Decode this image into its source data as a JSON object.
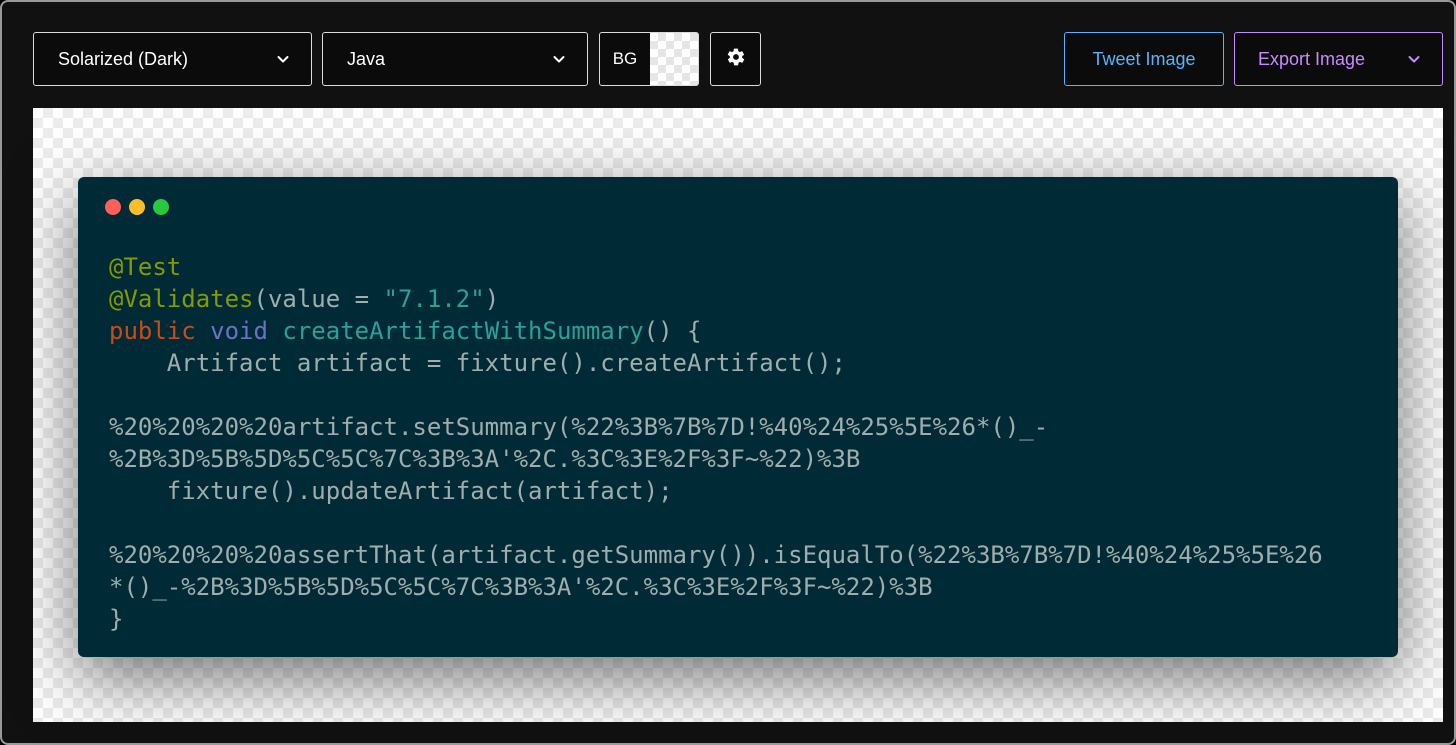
{
  "toolbar": {
    "theme_select": {
      "value": "Solarized (Dark)"
    },
    "language_select": {
      "value": "Java"
    },
    "bg_picker": {
      "label": "BG"
    },
    "tweet_button": {
      "label": "Tweet Image"
    },
    "export_button": {
      "label": "Export Image"
    },
    "icons": {
      "settings": "gear-icon",
      "dropdown": "chevron-down-icon"
    }
  },
  "window": {
    "controls": [
      "close",
      "minimize",
      "maximize"
    ],
    "colors": {
      "background": "#002b36",
      "close": "#ff5f56",
      "minimize": "#ffbd2e",
      "maximize": "#27c93f"
    }
  },
  "code": {
    "language": "Java",
    "lines": [
      [
        {
          "t": "@Test",
          "k": "ann"
        }
      ],
      [
        {
          "t": "@Validates",
          "k": "ann"
        },
        {
          "t": "(value = ",
          "k": "plain"
        },
        {
          "t": "\"7.1.2\"",
          "k": "str"
        },
        {
          "t": ")",
          "k": "plain"
        }
      ],
      [
        {
          "t": "public",
          "k": "kw"
        },
        {
          "t": " ",
          "k": "plain"
        },
        {
          "t": "void",
          "k": "type"
        },
        {
          "t": " ",
          "k": "plain"
        },
        {
          "t": "createArtifactWithSummary",
          "k": "fn"
        },
        {
          "t": "() {",
          "k": "plain"
        }
      ],
      [
        {
          "t": "    Artifact artifact = fixture().createArtifact();",
          "k": "plain"
        }
      ],
      [
        {
          "t": "",
          "k": "plain"
        }
      ],
      [
        {
          "t": "%20%20%20%20artifact.setSummary(%22%3B%7B%7D!%40%24%25%5E%26*()_-",
          "k": "plain"
        }
      ],
      [
        {
          "t": "%2B%3D%5B%5D%5C%5C%7C%3B%3A'%2C.%3C%3E%2F%3F~%22)%3B",
          "k": "plain"
        }
      ],
      [
        {
          "t": "    fixture().updateArtifact(artifact);",
          "k": "plain"
        }
      ],
      [
        {
          "t": "",
          "k": "plain"
        }
      ],
      [
        {
          "t": "%20%20%20%20assertThat(artifact.getSummary()).isEqualTo(%22%3B%7B%7D!%40%24%25%5E%26",
          "k": "plain"
        }
      ],
      [
        {
          "t": "*()_-%2B%3D%5B%5D%5C%5C%7C%3B%3A'%2C.%3C%3E%2F%3F~%22)%3B",
          "k": "plain"
        }
      ],
      [
        {
          "t": "}",
          "k": "plain"
        }
      ]
    ]
  }
}
